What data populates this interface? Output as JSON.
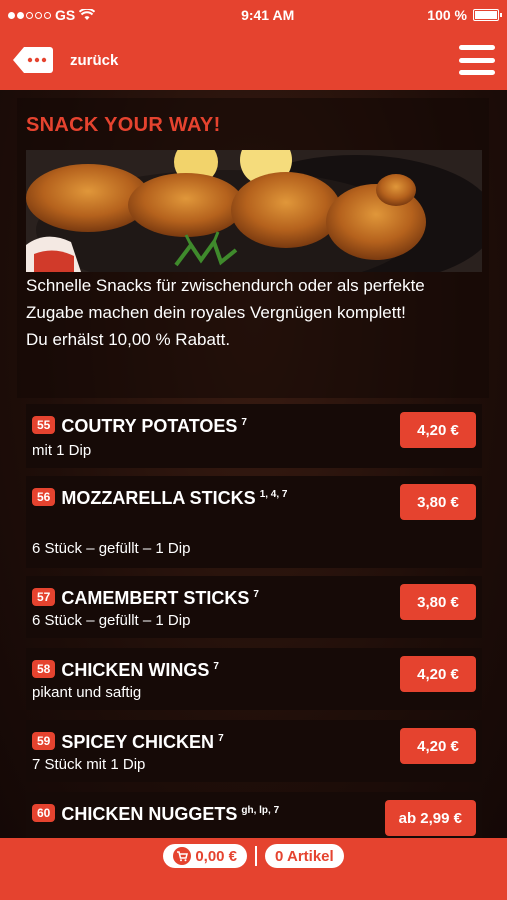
{
  "status_bar": {
    "carrier": "GS",
    "time": "9:41 AM",
    "battery": "100 %"
  },
  "nav": {
    "back_label": "zurück"
  },
  "section": {
    "title": "SNACK YOUR WAY!",
    "intro_line1": "Schnelle Snacks für zwischendurch oder als perfekte Zugabe machen dein royales Vergnügen komplett!",
    "intro_line2": "Du erhälst 10,00 % Rabatt."
  },
  "products": [
    {
      "number": "55",
      "name": "COUTRY POTATOES",
      "allergens": "7",
      "description": "mit 1 Dip",
      "price": "4,20 €"
    },
    {
      "number": "56",
      "name": "MOZZARELLA STICKS",
      "allergens": "1, 4, 7",
      "description": "6 Stück – gefüllt – 1 Dip",
      "price": "3,80 €"
    },
    {
      "number": "57",
      "name": "CAMEMBERT STICKS",
      "allergens": "7",
      "description": "6 Stück – gefüllt – 1 Dip",
      "price": "3,80 €"
    },
    {
      "number": "58",
      "name": "CHICKEN WINGS",
      "allergens": "7",
      "description": "pikant und saftig",
      "price": "4,20 €"
    },
    {
      "number": "59",
      "name": "SPICEY CHICKEN",
      "allergens": "7",
      "description": "7 Stück mit 1 Dip",
      "price": "4,20 €"
    },
    {
      "number": "60",
      "name": "CHICKEN NUGGETS",
      "allergens": "gh, lp, 7",
      "description": "",
      "price": "ab 2,99 €"
    }
  ],
  "cart": {
    "total": "0,00 €",
    "items": "0 Artikel"
  },
  "icons": {
    "back": "back-tag-icon",
    "menu": "hamburger-menu-icon",
    "cart": "cart-icon",
    "wifi": "wifi-icon",
    "battery": "battery-icon"
  },
  "colors": {
    "accent": "#e5432f",
    "background": "#1a0d08"
  }
}
